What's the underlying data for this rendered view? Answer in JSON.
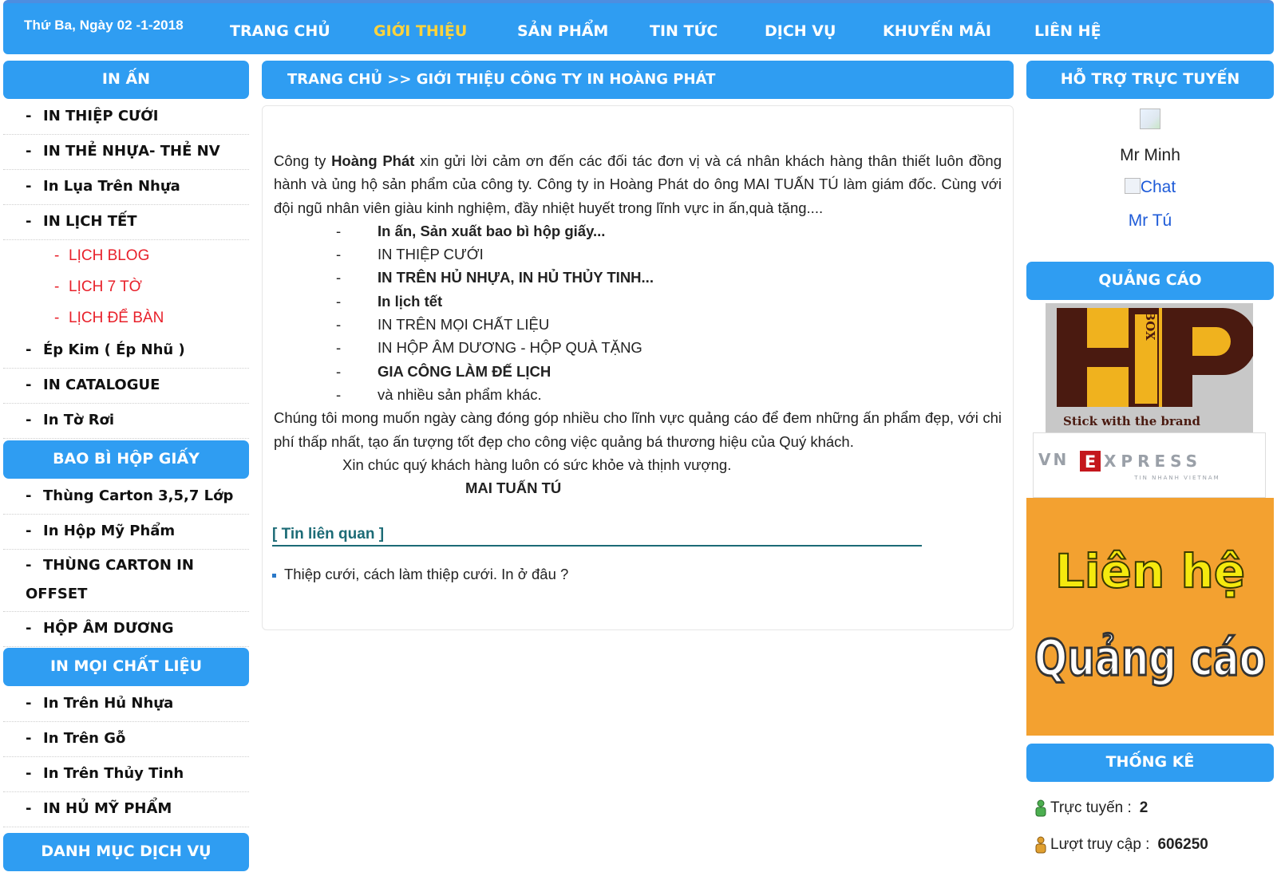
{
  "header": {
    "date": "Thứ Ba, Ngày 02 -1-2018",
    "nav": [
      {
        "label": "TRANG CHỦ",
        "active": false
      },
      {
        "label": "GIỚI THIỆU",
        "active": true
      },
      {
        "label": "SẢN PHẨM",
        "active": false
      },
      {
        "label": "TIN TỨC",
        "active": false
      },
      {
        "label": "DỊCH VỤ",
        "active": false
      },
      {
        "label": "KHUYẾN MÃI",
        "active": false
      },
      {
        "label": "LIÊN HỆ",
        "active": false
      }
    ]
  },
  "left": {
    "in_an": {
      "title": "IN ẤN",
      "items": [
        "IN THIỆP CƯỚI",
        "IN THẺ NHỰA- THẺ NV",
        "In Lụa Trên Nhựa",
        "IN LỊCH TẾT"
      ],
      "subitems": [
        "LỊCH BLOG",
        "LỊCH 7 TỜ",
        "LỊCH ĐỂ BÀN"
      ],
      "items2": [
        "Ép Kim ( Ép Nhũ )",
        "IN CATALOGUE",
        "In Tờ Rơi"
      ]
    },
    "bao_bi": {
      "title": "BAO BÌ HỘP GIẤY",
      "items": [
        "Thùng Carton 3,5,7 Lớp",
        "In Hộp Mỹ Phẩm",
        "THÙNG CARTON IN OFFSET",
        "HỘP ÂM DƯƠNG"
      ]
    },
    "chat_lieu": {
      "title": "IN MỌI CHẤT LIỆU",
      "items": [
        "In Trên Hủ Nhựa",
        "In Trên Gỗ",
        "In Trên Thủy Tinh",
        "IN HỦ MỸ PHẨM"
      ]
    },
    "dich_vu": {
      "title": "DANH MỤC DỊCH VỤ"
    }
  },
  "main": {
    "breadcrumb": "TRANG CHỦ >> GIỚI THIỆU CÔNG TY IN HOÀNG PHÁT",
    "intro_pre": "Công ty ",
    "intro_bold": "Hoàng Phát",
    "intro_post": " xin gửi lời cảm ơn đến các đối tác đơn vị và cá nhân khách hàng thân thiết luôn đồng hành và ủng hộ sản phẩm của công ty. Công ty in Hoàng Phát do ông MAI TUẤN TÚ làm giám đốc. Cùng với  đội ngũ nhân viên giàu kinh nghiệm, đầy nhiệt huyết trong lĩnh vực in ấn,quà tặng....",
    "bullets": [
      {
        "text": "In ấn, Sản xuất bao bì hộp giấy...",
        "bold": true
      },
      {
        "text": "IN THIỆP CƯỚI",
        "bold": false
      },
      {
        "text": "IN TRÊN HỦ NHỰA, IN HỦ THỦY TINH...",
        "bold": true
      },
      {
        "text": "In lịch tết",
        "bold": true
      },
      {
        "text": "IN TRÊN MỌI CHẤT LIỆU",
        "bold": false
      },
      {
        "text": "IN HỘP ÂM DƯƠNG - HỘP QUÀ TẶNG",
        "bold": false
      },
      {
        "text": "GIA CÔNG LÀM ĐẾ LỊCH",
        "bold": true
      },
      {
        "text": "và nhiều sản phẩm khác.",
        "bold": false
      }
    ],
    "bullet_dash": "-",
    "closing": "Chúng tôi mong muốn ngày càng đóng góp nhiều cho lĩnh vực quảng cáo để đem những ấn phẩm đẹp, với chi phí thấp nhất, tạo ấn tượng tốt đẹp cho công việc quảng bá thương hiệu của Quý khách.",
    "wish": "Xin chúc quý khách hàng luôn có sức khỏe và thịnh vượng.",
    "signature": "MAI TUẤN TÚ",
    "related_title": "[ Tin liên quan ]",
    "related": [
      "Thiệp cưới, cách làm thiệp cưới. In ở đâu ?"
    ]
  },
  "right": {
    "support_title": "HỖ TRỢ TRỰC TUYẾN",
    "support_name1": "Mr Minh",
    "support_chat_alt": "Chat",
    "support_name2": "Mr Tú",
    "ads_title": "QUẢNG CÁO",
    "ad_hp_tagline": "Stick with the brand",
    "ad_hp_box": "BOX",
    "ad_vn_text": "VNEXPRESS",
    "ad_vn_sub": "TIN NHANH VIETNAM",
    "ad_lh_line1": "Liên hệ",
    "ad_lh_line2": "Quảng cáo",
    "stats_title": "THỐNG KÊ",
    "online_label": "Trực tuyến :",
    "online_value": "2",
    "visits_label": "Lượt truy cập :",
    "visits_value": "606250"
  },
  "colors": {
    "brand_blue": "#2f9df2",
    "active_nav": "#ffd33c",
    "submenu_red": "#e8202a",
    "related_teal": "#1c6b76",
    "ad_orange": "#f3a130"
  }
}
